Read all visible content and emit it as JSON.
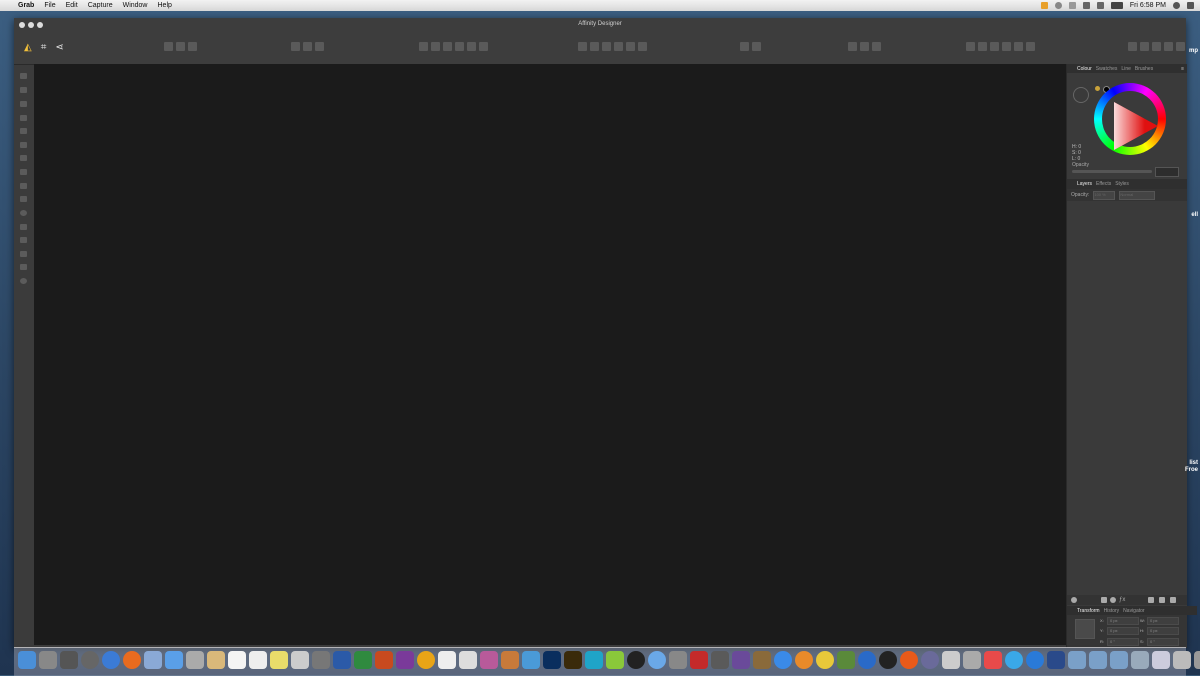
{
  "menubar": {
    "apple": "",
    "app_name": "Grab",
    "items": [
      "File",
      "Edit",
      "Capture",
      "Window",
      "Help"
    ],
    "clock": "Fri 6:58 PM"
  },
  "window": {
    "title": "Affinity Designer"
  },
  "toolbar": {
    "persona_icons": [
      "designer-persona-icon",
      "pixel-persona-icon",
      "export-persona-icon"
    ]
  },
  "panels": {
    "colour_tabs": [
      "Colour",
      "Swatches",
      "Line",
      "Brushes"
    ],
    "hsl": {
      "h": "H: 0",
      "s": "S: 0",
      "l": "L: 0"
    },
    "opacity_label": "Opacity",
    "layers_tabs": [
      "Layers",
      "Effects",
      "Styles"
    ],
    "layers_opacity_label": "Opacity:",
    "layers_opacity_value": "100 %",
    "blend_mode": "Normal",
    "transform_tabs": [
      "Transform",
      "History",
      "Navigator"
    ],
    "transform_fields": {
      "x_label": "X:",
      "x_value": "0 px",
      "y_label": "Y:",
      "y_value": "0 px",
      "w_label": "W:",
      "w_value": "0 px",
      "h_label": "H:",
      "h_value": "0 px",
      "r_label": "R:",
      "r_value": "0 °",
      "s_label": "S:",
      "s_value": "0 °"
    }
  },
  "desktop_side_text": {
    "line1": "mp",
    "line2": "ell",
    "line3": "list",
    "line4": "Froe"
  },
  "colors": {
    "canvas": "#1b1b1b",
    "chrome": "#3b3b3b",
    "accent_red": "#e01010"
  }
}
